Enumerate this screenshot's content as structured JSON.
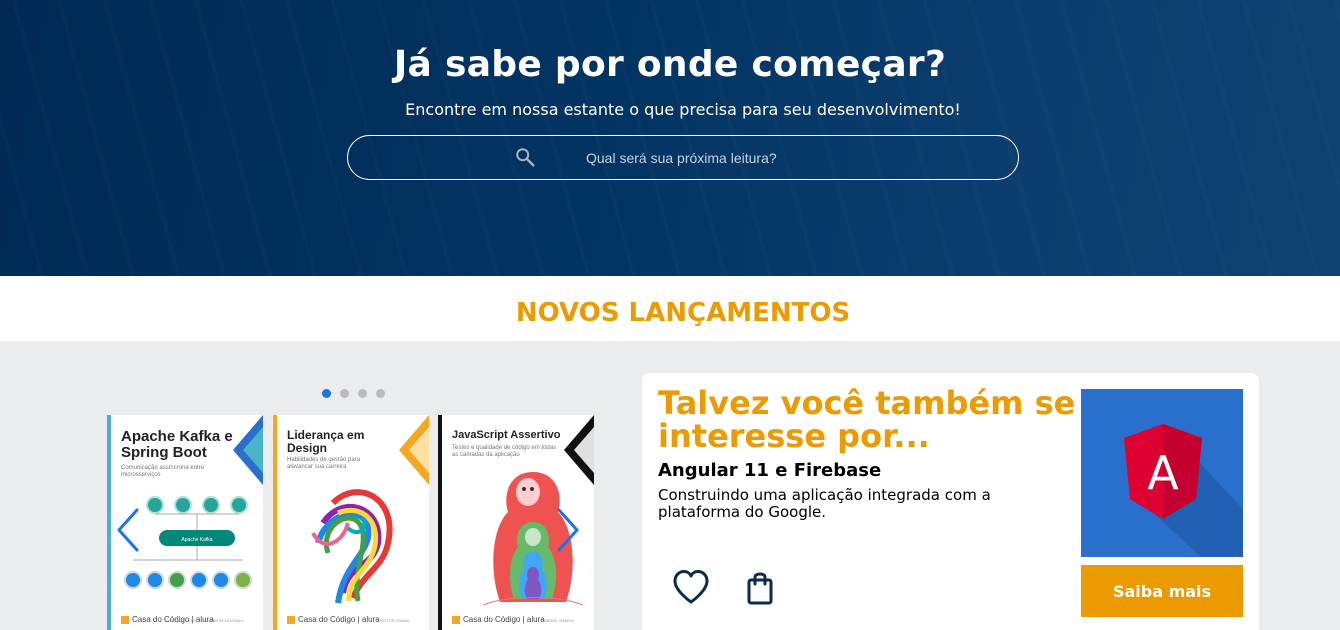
{
  "hero": {
    "title": "Já sabe por onde começar?",
    "subtitle": "Encontre em nossa estante o que precisa para seu desenvolvimento!",
    "search": {
      "placeholder": "Qual será sua próxima leitura?",
      "icon": "search-icon"
    }
  },
  "section": {
    "title": "NOVOS LANÇAMENTOS"
  },
  "carousel": {
    "dots": 4,
    "active_dot": 0,
    "books": [
      {
        "title": "Apache Kafka e Spring Boot",
        "subtitle": "Comunicação assíncrona entre microsserviços",
        "diagram_label": "Apache Kafka",
        "author": "EDUARDO FELIPE ZAMBOM SANTANA",
        "publisher": "Casa do Código | alura",
        "accent": "#4ab3c9"
      },
      {
        "title": "Liderança em Design",
        "subtitle": "Habilidades de gestão para alavancar sua carreira",
        "author": "VICTOR ZANINI",
        "publisher": "Casa do Código | alura",
        "accent": "#f5a623"
      },
      {
        "title": "JavaScript Assertivo",
        "subtitle": "Testes e qualidade de código em todas as camadas da aplicação",
        "author": "GABRIEL RAMOS",
        "publisher": "Casa do Código | alura",
        "accent": "#111111"
      }
    ],
    "prev_icon": "chevron-left-icon",
    "next_icon": "chevron-right-icon"
  },
  "suggestion": {
    "heading": "Talvez você também se interesse por...",
    "book_title": "Angular 11 e Firebase",
    "book_description": "Construindo uma aplicação integrada com a plataforma do Google.",
    "image_letter": "A",
    "button_label": "Saiba mais",
    "favorite_icon": "heart-icon",
    "cart_icon": "shopping-bag-icon"
  },
  "colors": {
    "hero_bg": "#002a54",
    "accent": "#eb9b00",
    "dot_active": "#1a73e8",
    "angular_bg": "#2a6fcb",
    "angular_red": "#dd0031"
  }
}
